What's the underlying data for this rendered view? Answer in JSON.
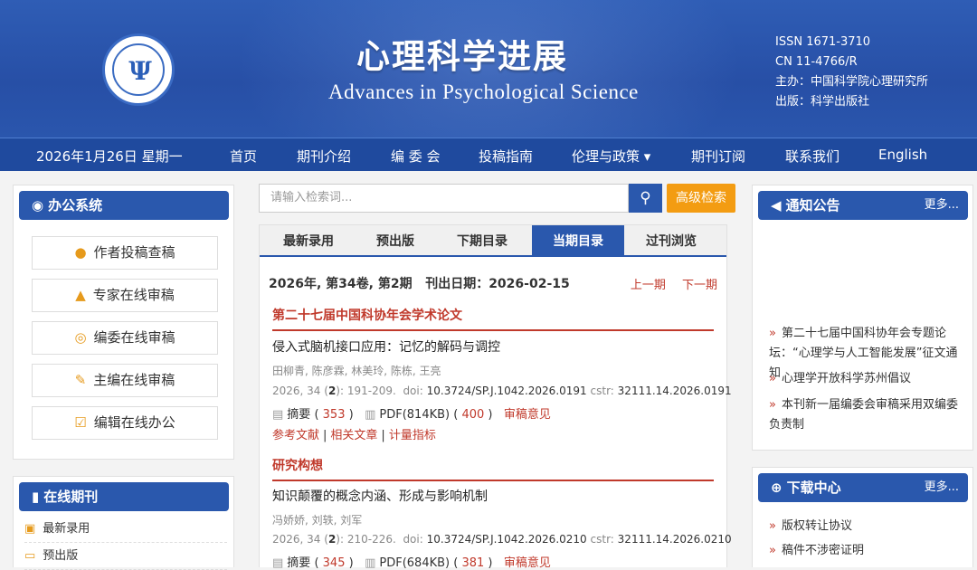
{
  "header": {
    "title_cn": "心理科学进展",
    "title_en": "Advances in Psychological Science",
    "issn": "ISSN 1671-3710",
    "cn": "CN 11-4766/R",
    "sponsor": "主办：中国科学院心理研究所",
    "publisher": "出版：科学出版社"
  },
  "nav": {
    "date": "2026年1月26日 星期一",
    "items": [
      "首页",
      "期刊介绍",
      "编 委 会",
      "投稿指南",
      "伦理与政策 ▾",
      "期刊订阅",
      "联系我们",
      "English"
    ]
  },
  "office": {
    "title": "办公系统",
    "buttons": [
      "作者投稿查稿",
      "专家在线审稿",
      "编委在线审稿",
      "主编在线审稿",
      "编辑在线办公"
    ]
  },
  "online_journal": {
    "title": "在线期刊",
    "items": [
      "最新录用",
      "预出版"
    ]
  },
  "search": {
    "placeholder": "请输入检索词...",
    "advanced": "高级检索"
  },
  "tabs": [
    "最新录用",
    "预出版",
    "下期目录",
    "当期目录",
    "过刊浏览"
  ],
  "issue": {
    "info": "2026年, 第34卷, 第2期   刊出日期：2026-02-15",
    "prev": "上一期",
    "next": "下一期"
  },
  "sections": [
    {
      "name": "第二十七届中国科协年会学术论文",
      "article": {
        "title": "侵入式脑机接口应用：记忆的解码与调控",
        "authors": "田柳青, 陈彦霖, 林美玲, 陈栋, 王亮",
        "year_vol": "2026, 34 (",
        "issue_no": "2",
        "pages": "):  191-209.",
        "doi_label": "doi:",
        "doi": "10.3724/SP.J.1042.2026.0191",
        "cstr_label": "cstr:",
        "cstr": "32111.14.2026.0191",
        "abstract_label": "摘要",
        "abstract_count": "353",
        "pdf_label": "PDF(814KB)",
        "pdf_count": "400",
        "review": "审稿意见",
        "extra": [
          "参考文献",
          "相关文章",
          "计量指标"
        ]
      }
    },
    {
      "name": "研究构想",
      "article": {
        "title": "知识颠覆的概念内涵、形成与影响机制",
        "authors": "冯娇娇, 刘轶, 刘军",
        "year_vol": "2026, 34 (",
        "issue_no": "2",
        "pages": "):  210-226.",
        "doi_label": "doi:",
        "doi": "10.3724/SP.J.1042.2026.0210",
        "cstr_label": "cstr:",
        "cstr": "32111.14.2026.0210",
        "abstract_label": "摘要",
        "abstract_count": "345",
        "pdf_label": "PDF(684KB)",
        "pdf_count": "381",
        "review": "审稿意见"
      }
    }
  ],
  "notices": {
    "title": "通知公告",
    "more": "更多...",
    "items": [
      "第二十七届中国科协年会专题论坛：“心理学与人工智能发展”征文通知",
      "心理学开放科学苏州倡议",
      "本刊新一届编委会审稿采用双编委负责制"
    ]
  },
  "downloads": {
    "title": "下载中心",
    "more": "更多...",
    "items": [
      "版权转让协议",
      "稿件不涉密证明"
    ]
  },
  "colors": {
    "primary": "#2a58ad",
    "accent": "#f39c12",
    "red": "#c0392b"
  }
}
